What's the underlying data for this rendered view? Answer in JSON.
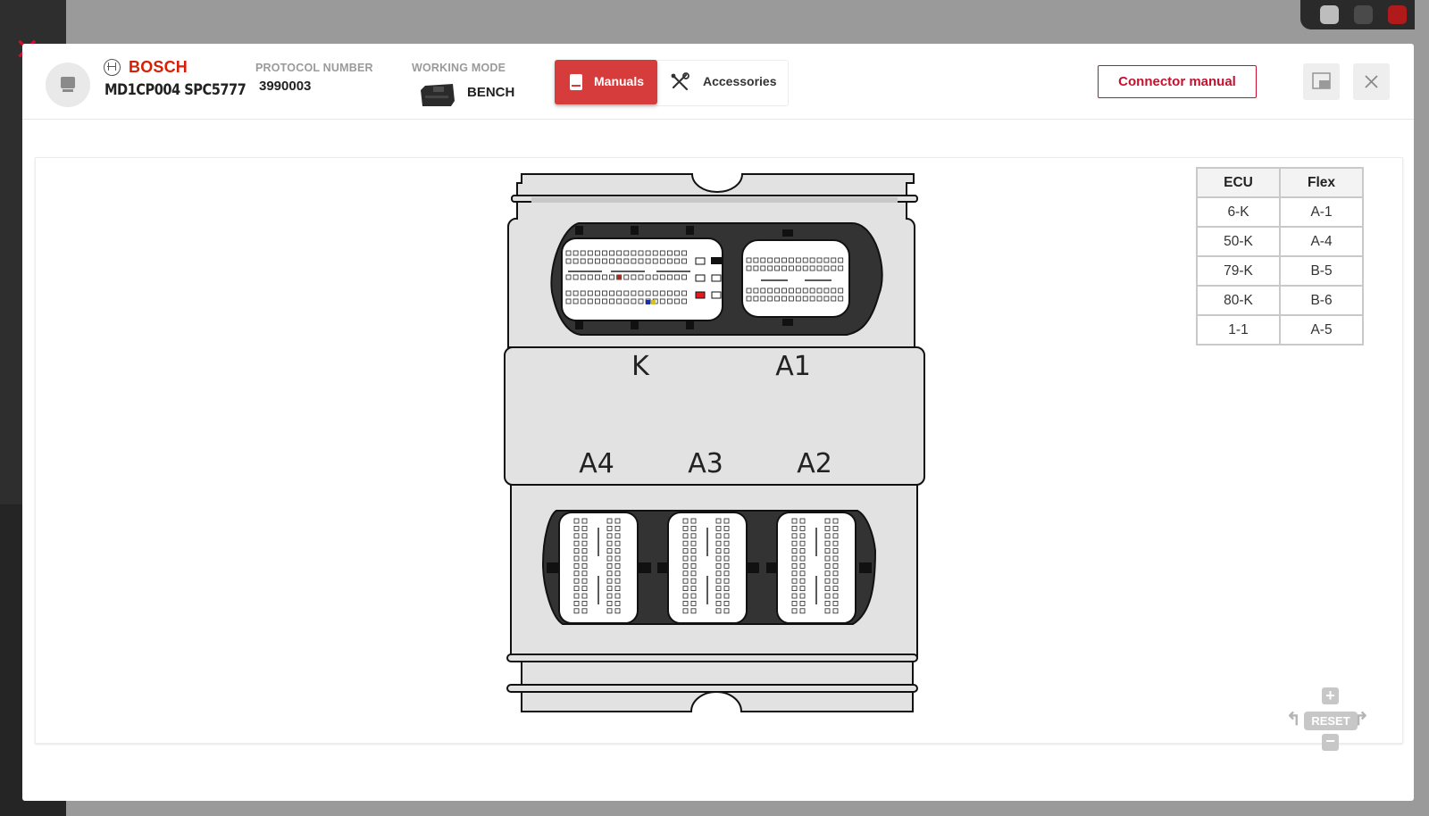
{
  "header": {
    "brand": "BOSCH",
    "ecu_model": "MD1CP004 SPC5777",
    "protocol_label": "PROTOCOL NUMBER",
    "protocol_value": "3990003",
    "mode_label": "WORKING MODE",
    "mode_value": "BENCH",
    "tabs": [
      {
        "label": "Manuals",
        "active": true,
        "icon": "book-icon"
      },
      {
        "label": "Accessories",
        "active": false,
        "icon": "tools-icon"
      }
    ],
    "connector_button": "Connector manual",
    "accent_color": "#d73c3c"
  },
  "diagram": {
    "connector_labels": {
      "k": "K",
      "a1": "A1",
      "a4": "A4",
      "a3": "A3",
      "a2": "A2"
    }
  },
  "pin_table": {
    "headers": [
      "ECU",
      "Flex"
    ],
    "rows": [
      [
        "6-K",
        "A-1"
      ],
      [
        "50-K",
        "A-4"
      ],
      [
        "79-K",
        "B-5"
      ],
      [
        "80-K",
        "B-6"
      ],
      [
        "1-1",
        "A-5"
      ]
    ]
  },
  "zoom_controls": {
    "zoom_in": "+",
    "reset": "RESET",
    "zoom_out": "−"
  }
}
